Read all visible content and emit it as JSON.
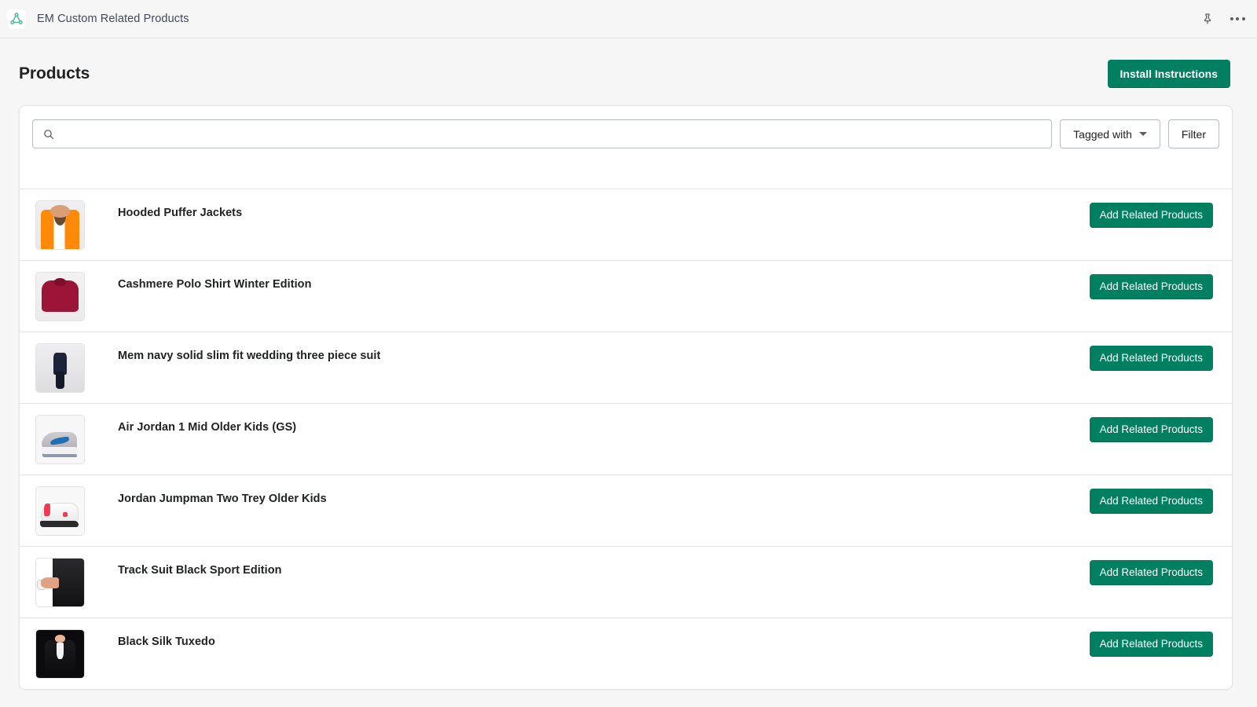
{
  "appbar": {
    "icon": "related-products-nodes-icon",
    "title": "EM Custom Related Products",
    "pin_icon": "pin-icon",
    "more_icon": "more-horizontal-icon"
  },
  "page": {
    "title": "Products",
    "primary_action": "Install Instructions"
  },
  "filters": {
    "search_icon": "search-icon",
    "search_value": "",
    "search_placeholder": "",
    "tagged_with_label": "Tagged with",
    "filter_label": "Filter"
  },
  "colors": {
    "brand_green": "#008060",
    "page_background": "#f6f6f7",
    "card_background": "#ffffff",
    "border": "#e1e3e5",
    "text_primary": "#202223",
    "app_icon_teal": "#45b192"
  },
  "products": [
    {
      "title": "Hooded Puffer Jackets",
      "action": "Add Related Products",
      "art": "art-jacket",
      "thumb_alt": "woman-in-orange-puffer-jacket"
    },
    {
      "title": "Cashmere Polo Shirt Winter Edition",
      "action": "Add Related Products",
      "art": "art-polo",
      "thumb_alt": "burgundy-polo-shirt"
    },
    {
      "title": "Mem navy solid slim fit wedding three piece suit",
      "action": "Add Related Products",
      "art": "art-suit",
      "thumb_alt": "man-in-navy-three-piece-suit"
    },
    {
      "title": "Air Jordan 1 Mid Older Kids (GS)",
      "action": "Add Related Products",
      "art": "art-aj1",
      "thumb_alt": "grey-blue-air-jordan-1-sneaker"
    },
    {
      "title": "Jordan Jumpman Two Trey Older Kids",
      "action": "Add Related Products",
      "art": "art-jump",
      "thumb_alt": "white-red-jordan-jumpman-sneaker"
    },
    {
      "title": "Track Suit Black Sport Edition",
      "action": "Add Related Products",
      "art": "art-track",
      "thumb_alt": "black-track-suit-jacket"
    },
    {
      "title": "Black Silk Tuxedo",
      "action": "Add Related Products",
      "art": "art-tux",
      "thumb_alt": "man-in-black-silk-tuxedo"
    }
  ]
}
